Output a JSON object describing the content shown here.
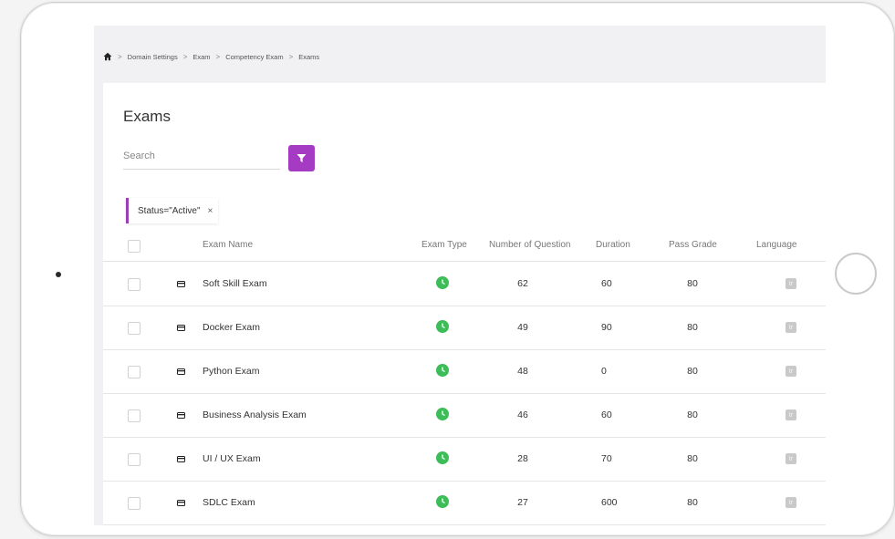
{
  "breadcrumb": {
    "items": [
      "Domain Settings",
      "Exam",
      "Competency Exam",
      "Exams"
    ],
    "separator": ">"
  },
  "page": {
    "title": "Exams"
  },
  "search": {
    "placeholder": "Search",
    "value": ""
  },
  "filter": {
    "chip_label": "Status=\"Active\"",
    "remove_label": "×"
  },
  "table": {
    "columns": {
      "exam_name": "Exam Name",
      "exam_type": "Exam Type",
      "number_of_question": "Number of Question",
      "duration": "Duration",
      "pass_grade": "Pass Grade",
      "language": "Language"
    },
    "rows": [
      {
        "name": "Soft Skill Exam",
        "questions": "62",
        "duration": "60",
        "pass_grade": "80",
        "language": "tr"
      },
      {
        "name": "Docker Exam",
        "questions": "49",
        "duration": "90",
        "pass_grade": "80",
        "language": "tr"
      },
      {
        "name": "Python Exam",
        "questions": "48",
        "duration": "0",
        "pass_grade": "80",
        "language": "tr"
      },
      {
        "name": "Business Analysis Exam",
        "questions": "46",
        "duration": "60",
        "pass_grade": "80",
        "language": "tr"
      },
      {
        "name": "UI / UX Exam",
        "questions": "28",
        "duration": "70",
        "pass_grade": "80",
        "language": "tr"
      },
      {
        "name": "SDLC Exam",
        "questions": "27",
        "duration": "600",
        "pass_grade": "80",
        "language": "tr"
      }
    ]
  },
  "colors": {
    "accent": "#a53bc3",
    "exam_type_active": "#3dbd57"
  }
}
